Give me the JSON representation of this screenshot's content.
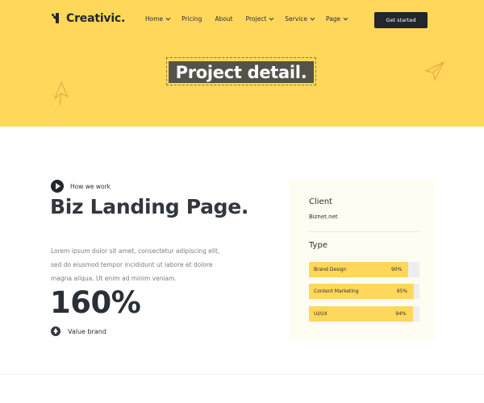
{
  "brand": {
    "name": "Creativic."
  },
  "nav": [
    {
      "label": "Home",
      "dropdown": true
    },
    {
      "label": "Pricing",
      "dropdown": false
    },
    {
      "label": "About",
      "dropdown": false
    },
    {
      "label": "Project",
      "dropdown": true
    },
    {
      "label": "Service",
      "dropdown": true
    },
    {
      "label": "Page",
      "dropdown": true
    }
  ],
  "cta": {
    "label": "Get started"
  },
  "hero": {
    "title": "Project detail."
  },
  "section": {
    "eyebrow": "How we work",
    "title": "Biz Landing Page.",
    "description": "Lorem ipsum dolor sit amet, consectetur adipiscing elit, sed do eiusmod tempor incididunt ut labore et dolore magna aliqua. Ut enim ad minim veniam.",
    "stat": "160%",
    "stat_label": "Value brand"
  },
  "card": {
    "client_heading": "Client",
    "client_value": "Biznet.net",
    "type_heading": "Type",
    "skills": [
      {
        "label": "Brand Design",
        "percent_text": "90%",
        "percent": 90
      },
      {
        "label": "Content Marketing",
        "percent_text": "95%",
        "percent": 95
      },
      {
        "label": "UI/UX",
        "percent_text": "94%",
        "percent": 94
      }
    ]
  },
  "colors": {
    "accent": "#ffd75a",
    "dark": "#23262b",
    "card_bg": "#fffcf2",
    "track": "#eeeeee"
  },
  "icons": {
    "play": "play-icon",
    "up": "arrow-up-circle-icon",
    "plane": "paper-plane-icon"
  }
}
